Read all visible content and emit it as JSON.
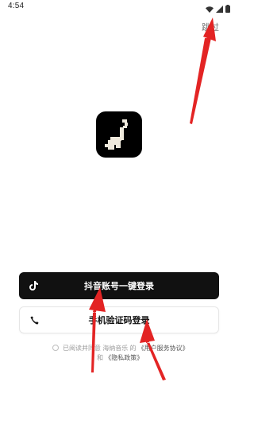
{
  "status_bar": {
    "time": "4:54"
  },
  "top": {
    "skip_label": "跳过"
  },
  "buttons": {
    "douyin_login": "抖音账号一键登录",
    "phone_login": "手机验证码登录"
  },
  "agreement": {
    "prefix": "已阅读并同意 海纳音乐 的",
    "user_service": "《用户服务协议》",
    "conjunction": "和",
    "privacy": "《隐私政策》"
  },
  "colors": {
    "primary_button": "#111111",
    "annotation_arrow": "#e32424"
  },
  "icons": {
    "logo": "music-note-key-icon",
    "douyin": "douyin-icon",
    "phone": "phone-icon",
    "wifi": "wifi-icon",
    "signal": "signal-icon",
    "battery": "battery-icon"
  }
}
